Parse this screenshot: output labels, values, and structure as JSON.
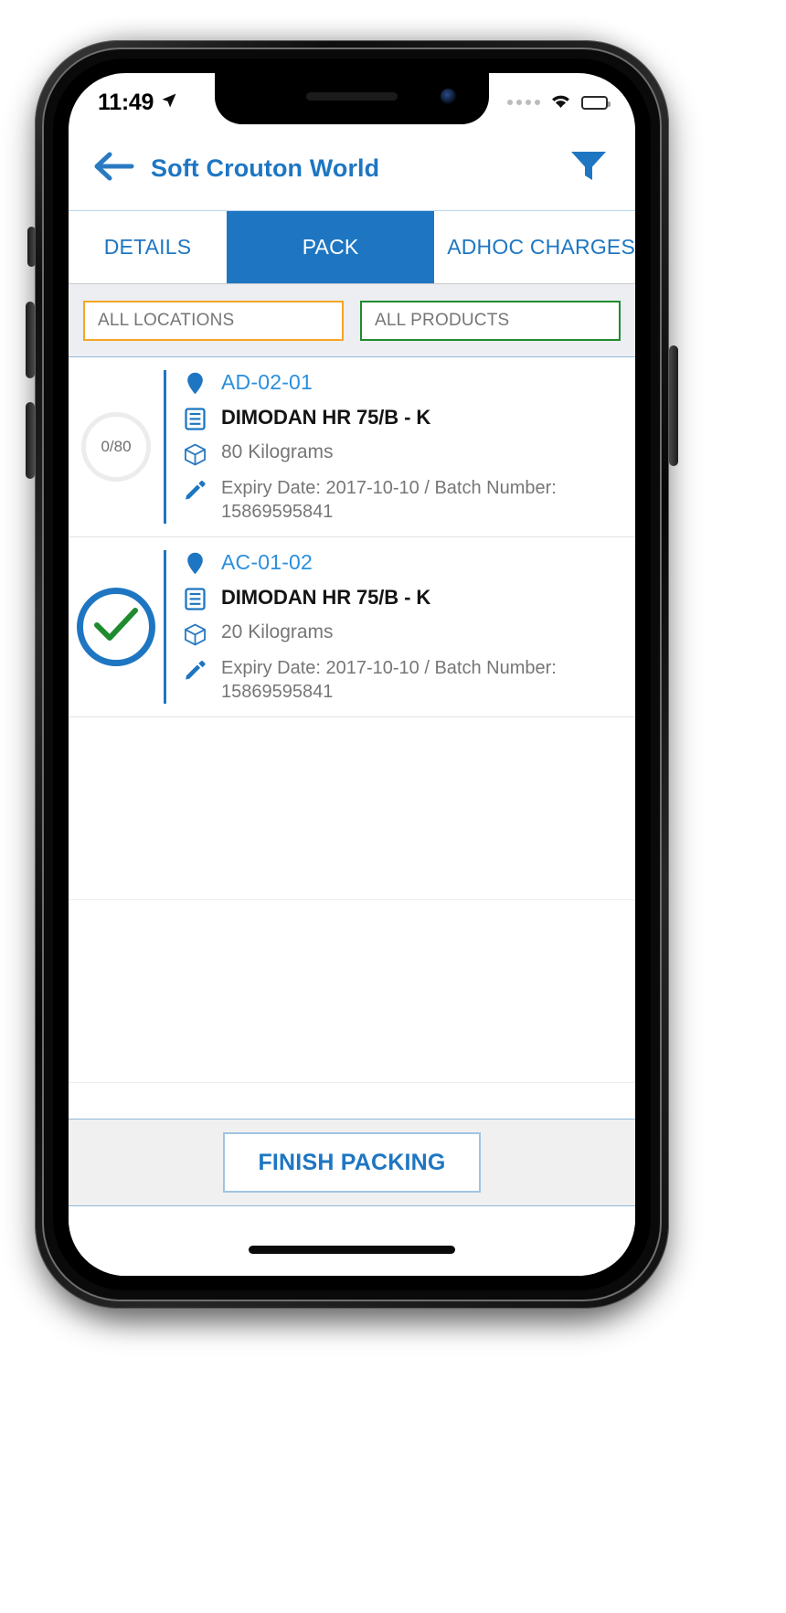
{
  "status_bar": {
    "time": "11:49",
    "location_icon": "location-arrow-icon",
    "signal_icon": "signal-dots-icon",
    "wifi_icon": "wifi-icon",
    "battery_icon": "battery-icon"
  },
  "app_bar": {
    "back_icon": "back-arrow-icon",
    "title": "Soft Crouton World",
    "filter_icon": "filter-funnel-icon"
  },
  "tabs": [
    {
      "label": "DETAILS",
      "active": false
    },
    {
      "label": "PACK",
      "active": true
    },
    {
      "label": "ADHOC CHARGES",
      "active": false
    }
  ],
  "filters": {
    "locations": {
      "label": "ALL LOCATIONS",
      "border_color": "#f5a623"
    },
    "products": {
      "label": "ALL PRODUCTS",
      "border_color": "#1f8b2e"
    }
  },
  "pack_list": [
    {
      "status": "pending",
      "progress_label": "0/80",
      "location": "AD-02-01",
      "product": "DIMODAN HR 75/B - K",
      "quantity": "80 Kilograms",
      "meta": "Expiry Date: 2017-10-10 / Batch Number: 15869595841",
      "location_icon": "map-pin-icon",
      "product_icon": "document-lines-icon",
      "quantity_icon": "package-box-icon",
      "meta_icon": "pencil-edit-icon"
    },
    {
      "status": "complete",
      "progress_label": "",
      "location": "AC-01-02",
      "product": "DIMODAN HR 75/B - K",
      "quantity": "20 Kilograms",
      "meta": "Expiry Date: 2017-10-10 / Batch Number: 15869595841",
      "location_icon": "map-pin-icon",
      "product_icon": "document-lines-icon",
      "quantity_icon": "package-box-icon",
      "meta_icon": "pencil-edit-icon",
      "check_icon": "green-check-icon"
    }
  ],
  "bottom": {
    "finish_label": "FINISH PACKING"
  },
  "colors": {
    "brand_blue": "#1e76c2",
    "link_blue": "#2a8fdd",
    "check_green": "#1f8b2e",
    "orange": "#f5a623",
    "muted_text": "#767676"
  }
}
